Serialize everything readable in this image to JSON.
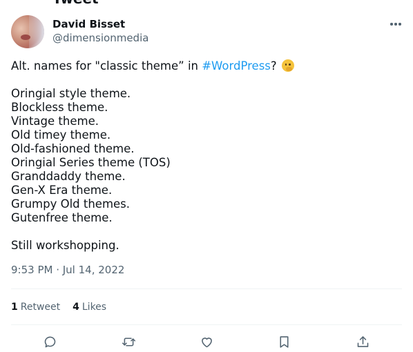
{
  "header": {
    "title": "Tweet"
  },
  "author": {
    "name": "David Bisset",
    "handle": "@dimensionmedia"
  },
  "tweet": {
    "intro_prefix": "Alt. names for \"classic theme” in ",
    "hashtag": "#WordPress",
    "intro_suffix": "?",
    "emoji": "thinking-face",
    "list": [
      "Oringial style theme.",
      "Blockless theme.",
      "Vintage theme.",
      "Old timey theme.",
      "Old-fashioned theme.",
      "Oringial Series theme (TOS)",
      "Granddaddy theme.",
      "Gen-X Era theme.",
      "Grumpy Old themes.",
      "Gutenfree theme."
    ],
    "closing": "Still workshopping.",
    "timestamp": "9:53 PM · Jul 14, 2022"
  },
  "stats": {
    "retweets_count": "1",
    "retweets_label": "Retweet",
    "likes_count": "4",
    "likes_label": "Likes"
  },
  "actions": [
    "reply-icon",
    "retweet-icon",
    "like-icon",
    "bookmark-icon",
    "share-icon"
  ],
  "colors": {
    "accent": "#1d9bf0",
    "secondary_text": "#536471",
    "divider": "#eff3f4"
  }
}
